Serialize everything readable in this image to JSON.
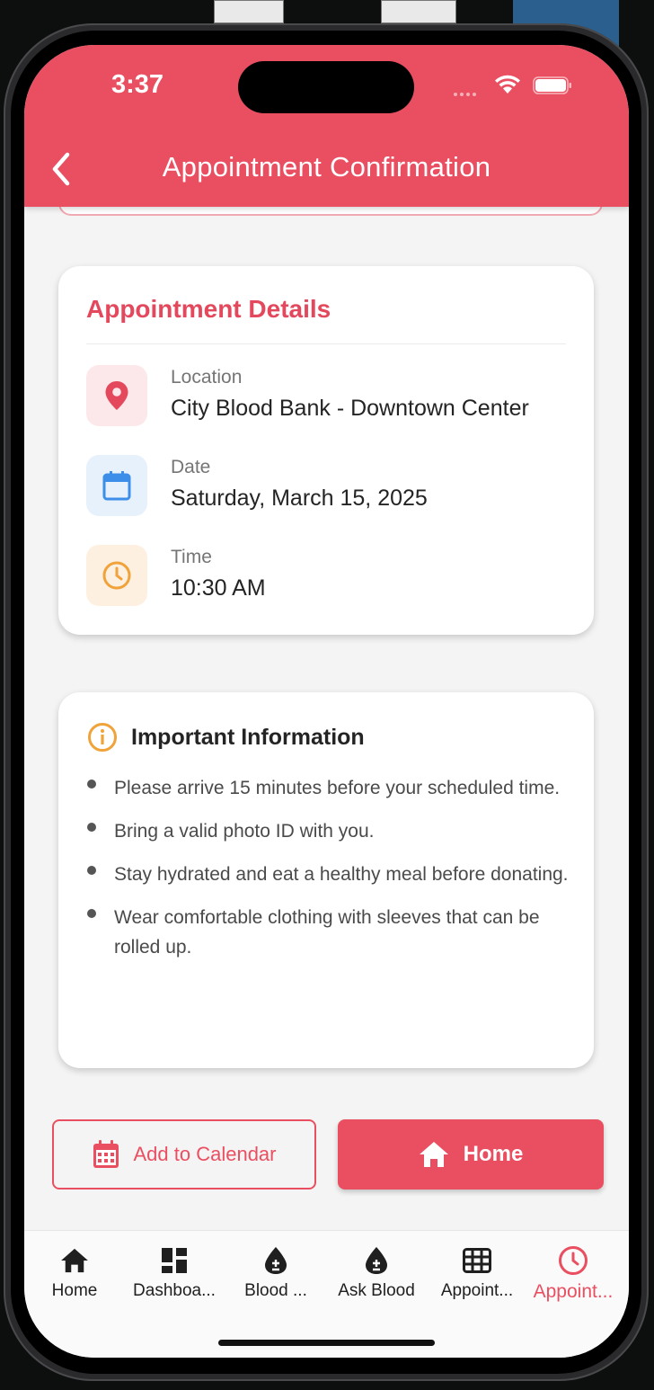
{
  "status_bar": {
    "time": "3:37"
  },
  "header": {
    "title": "Appointment Confirmation"
  },
  "details_card": {
    "heading": "Appointment Details",
    "rows": [
      {
        "label": "Location",
        "value": "City Blood Bank - Downtown Center",
        "icon": "location-pin-icon",
        "color": "#e4485d"
      },
      {
        "label": "Date",
        "value": "Saturday, March 15, 2025",
        "icon": "calendar-icon",
        "color": "#3d8ee8"
      },
      {
        "label": "Time",
        "value": "10:30 AM",
        "icon": "clock-icon",
        "color": "#f0a33a"
      }
    ]
  },
  "info_card": {
    "title": "Important Information",
    "items": [
      "Please arrive 15 minutes before your scheduled time.",
      "Bring a valid photo ID with you.",
      "Stay hydrated and eat a healthy meal before donating.",
      "Wear comfortable clothing with sleeves that can be rolled up."
    ]
  },
  "actions": {
    "add_to_calendar": "Add to Calendar",
    "home": "Home"
  },
  "bottom_nav": [
    {
      "label": "Home",
      "icon": "home-icon"
    },
    {
      "label": "Dashboa...",
      "icon": "dashboard-icon"
    },
    {
      "label": "Blood ...",
      "icon": "blood-drop-icon"
    },
    {
      "label": "Ask Blood",
      "icon": "blood-drop-icon"
    },
    {
      "label": "Appoint...",
      "icon": "grid-icon"
    },
    {
      "label": "Appoint...",
      "icon": "clock-icon",
      "active": true
    }
  ],
  "colors": {
    "primary": "#ea4f61",
    "background": "#f4f4f4",
    "card": "#ffffff"
  }
}
